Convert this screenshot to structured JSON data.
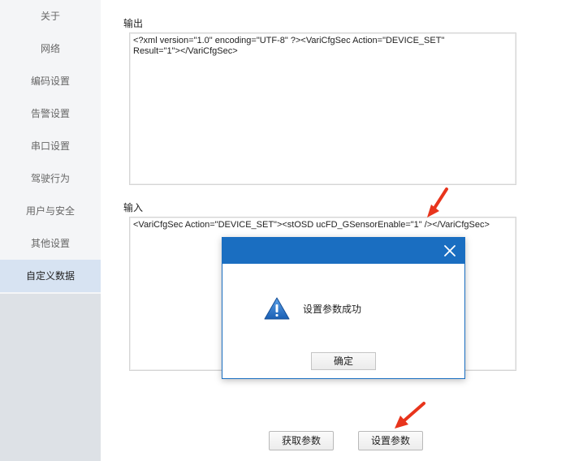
{
  "sidebar": {
    "items": [
      {
        "label": "关于"
      },
      {
        "label": "网络"
      },
      {
        "label": "编码设置"
      },
      {
        "label": "告警设置"
      },
      {
        "label": "串口设置"
      },
      {
        "label": "驾驶行为"
      },
      {
        "label": "用户与安全"
      },
      {
        "label": "其他设置"
      },
      {
        "label": "自定义数据"
      }
    ],
    "active_index": 8
  },
  "output": {
    "label": "输出",
    "text": "<?xml version=\"1.0\" encoding=\"UTF-8\" ?><VariCfgSec Action=\"DEVICE_SET\"\nResult=\"1\"></VariCfgSec>"
  },
  "input": {
    "label": "输入",
    "text": "<VariCfgSec Action=\"DEVICE_SET\"><stOSD ucFD_GSensorEnable=\"1\" /></VariCfgSec>"
  },
  "buttons": {
    "get_params": "获取参数",
    "set_params": "设置参数"
  },
  "dialog": {
    "message": "设置参数成功",
    "ok_label": "确定",
    "icon": "warning-icon",
    "header_color": "#1a6ec1"
  },
  "annotations": {
    "arrow_color": "#e8341c"
  }
}
